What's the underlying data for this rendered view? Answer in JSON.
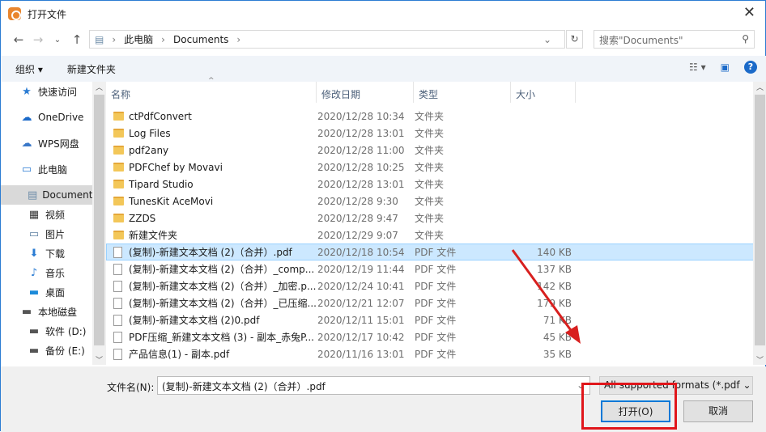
{
  "title": "打开文件",
  "nav": {
    "breadcrumb": [
      "此电脑",
      "Documents"
    ],
    "search_placeholder": "搜索\"Documents\""
  },
  "toolbar": {
    "organize": "组织 ▾",
    "new_folder": "新建文件夹"
  },
  "sidebar": [
    {
      "label": "快速访问",
      "icon": "star-icon",
      "glyph": "★",
      "color": "#2b7cd3"
    },
    {
      "label": "OneDrive",
      "icon": "cloud-icon",
      "glyph": "☁",
      "color": "#1b6ac9"
    },
    {
      "label": "WPS网盘",
      "icon": "cloud-icon",
      "glyph": "☁",
      "color": "#3a78c8"
    },
    {
      "label": "此电脑",
      "icon": "computer-icon",
      "glyph": "▭",
      "color": "#2b7cd3"
    },
    {
      "label": "Documents",
      "icon": "document-icon",
      "glyph": "▤",
      "color": "#6d8ca8",
      "sub": true,
      "selected": true
    },
    {
      "label": "视频",
      "icon": "video-icon",
      "glyph": "▦",
      "color": "#333",
      "sub": true
    },
    {
      "label": "图片",
      "icon": "picture-icon",
      "glyph": "▭",
      "color": "#5a7ea0",
      "sub": true
    },
    {
      "label": "下载",
      "icon": "download-icon",
      "glyph": "⬇",
      "color": "#2b7cd3",
      "sub": true
    },
    {
      "label": "音乐",
      "icon": "music-icon",
      "glyph": "♪",
      "color": "#2b7cd3",
      "sub": true
    },
    {
      "label": "桌面",
      "icon": "desktop-icon",
      "glyph": "▬",
      "color": "#1b8ad9",
      "sub": true
    },
    {
      "label": "本地磁盘",
      "icon": "drive-icon",
      "glyph": "▬",
      "color": "#555"
    },
    {
      "label": "软件 (D:)",
      "icon": "drive-icon",
      "glyph": "▬",
      "color": "#555",
      "sub": true
    },
    {
      "label": "备份 (E:)",
      "icon": "drive-icon",
      "glyph": "▬",
      "color": "#555",
      "sub": true
    }
  ],
  "columns": [
    "名称",
    "修改日期",
    "类型",
    "大小"
  ],
  "files": [
    {
      "name": "ctPdfConvert",
      "date": "2020/12/28 10:34",
      "type": "文件夹",
      "size": "",
      "folder": true
    },
    {
      "name": "Log Files",
      "date": "2020/12/28 13:01",
      "type": "文件夹",
      "size": "",
      "folder": true
    },
    {
      "name": "pdf2any",
      "date": "2020/12/28 11:00",
      "type": "文件夹",
      "size": "",
      "folder": true
    },
    {
      "name": "PDFChef by Movavi",
      "date": "2020/12/28 10:25",
      "type": "文件夹",
      "size": "",
      "folder": true
    },
    {
      "name": "Tipard Studio",
      "date": "2020/12/28 13:01",
      "type": "文件夹",
      "size": "",
      "folder": true
    },
    {
      "name": "TunesKit AceMovi",
      "date": "2020/12/28 9:30",
      "type": "文件夹",
      "size": "",
      "folder": true
    },
    {
      "name": "ZZDS",
      "date": "2020/12/28 9:47",
      "type": "文件夹",
      "size": "",
      "folder": true
    },
    {
      "name": "新建文件夹",
      "date": "2020/12/29 9:07",
      "type": "文件夹",
      "size": "",
      "folder": true
    },
    {
      "name": "(复制)-新建文本文档 (2)（合并）.pdf",
      "date": "2020/12/18 10:54",
      "type": "PDF 文件",
      "size": "140 KB",
      "selected": true
    },
    {
      "name": "(复制)-新建文本文档 (2)（合并）_comp...",
      "date": "2020/12/19 11:44",
      "type": "PDF 文件",
      "size": "137 KB"
    },
    {
      "name": "(复制)-新建文本文档 (2)（合并）_加密.p...",
      "date": "2020/12/24 10:41",
      "type": "PDF 文件",
      "size": "142 KB"
    },
    {
      "name": "(复制)-新建文本文档 (2)（合并）_已压缩...",
      "date": "2020/12/21 12:07",
      "type": "PDF 文件",
      "size": "179 KB"
    },
    {
      "name": "(复制)-新建文本文档 (2)0.pdf",
      "date": "2020/12/11 15:01",
      "type": "PDF 文件",
      "size": "71 KB"
    },
    {
      "name": "PDF压缩_新建文本文档 (3) - 副本_赤兔P...",
      "date": "2020/12/17 10:42",
      "type": "PDF 文件",
      "size": "45 KB"
    },
    {
      "name": "产品信息(1) - 副本.pdf",
      "date": "2020/11/16 13:01",
      "type": "PDF 文件",
      "size": "35 KB"
    }
  ],
  "bottom": {
    "filename_label": "文件名(N):",
    "filename_value": "(复制)-新建文本文档 (2)（合并）.pdf",
    "filetype": "All supported formats (*.pdf",
    "open": "打开(O)",
    "cancel": "取消"
  }
}
